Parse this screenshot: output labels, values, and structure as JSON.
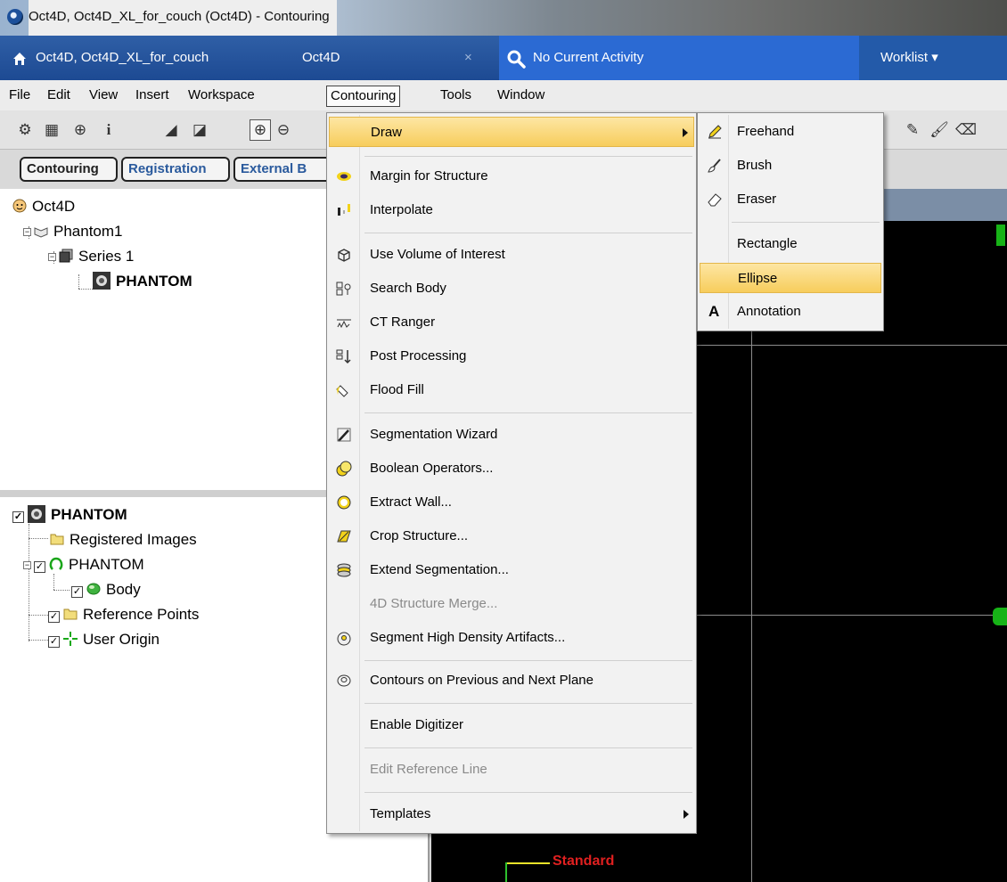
{
  "window": {
    "title": "Oct4D, Oct4D_XL_for_couch (Oct4D) - Contouring"
  },
  "header": {
    "patient": "Oct4D, Oct4D_XL_for_couch",
    "case": "Oct4D",
    "close": "×",
    "activity": "No Current Activity",
    "worklist": "Worklist ▾"
  },
  "menubar": [
    "File",
    "Edit",
    "View",
    "Insert",
    "Workspace",
    "Contouring",
    "Tools",
    "Window"
  ],
  "tabs": {
    "contouring": "Contouring",
    "registration": "Registration",
    "external": "External B"
  },
  "patient_tree": {
    "root": "Oct4D",
    "study": "Phantom1",
    "series": "Series 1",
    "image": "PHANTOM"
  },
  "structure_tree": {
    "root": "PHANTOM",
    "registered": "Registered Images",
    "set": "PHANTOM",
    "body": "Body",
    "refpoints": "Reference Points",
    "origin": "User Origin"
  },
  "viewer": {
    "label": "Standard"
  },
  "contouring_menu": {
    "draw": "Draw",
    "margin": "Margin for Structure",
    "interpolate": "Interpolate",
    "voi": "Use Volume of Interest",
    "search_body": "Search Body",
    "ct_ranger": "CT Ranger",
    "post_processing": "Post Processing",
    "flood_fill": "Flood Fill",
    "seg_wizard": "Segmentation Wizard",
    "boolean": "Boolean Operators...",
    "extract_wall": "Extract Wall...",
    "crop": "Crop Structure...",
    "extend_seg": "Extend Segmentation...",
    "merge4d": "4D Structure Merge...",
    "high_density": "Segment High Density Artifacts...",
    "prev_next": "Contours on Previous and Next Plane",
    "digitizer": "Enable Digitizer",
    "ref_line": "Edit Reference Line",
    "templates": "Templates"
  },
  "draw_submenu": {
    "freehand": "Freehand",
    "brush": "Brush",
    "eraser": "Eraser",
    "rectangle": "Rectangle",
    "ellipse": "Ellipse",
    "annotation": "Annotation",
    "annotation_glyph": "A"
  },
  "colors": {
    "highlight": "#f7cd5c",
    "header_blue": "#1d4a93",
    "activity_blue": "#2b6ad3"
  }
}
